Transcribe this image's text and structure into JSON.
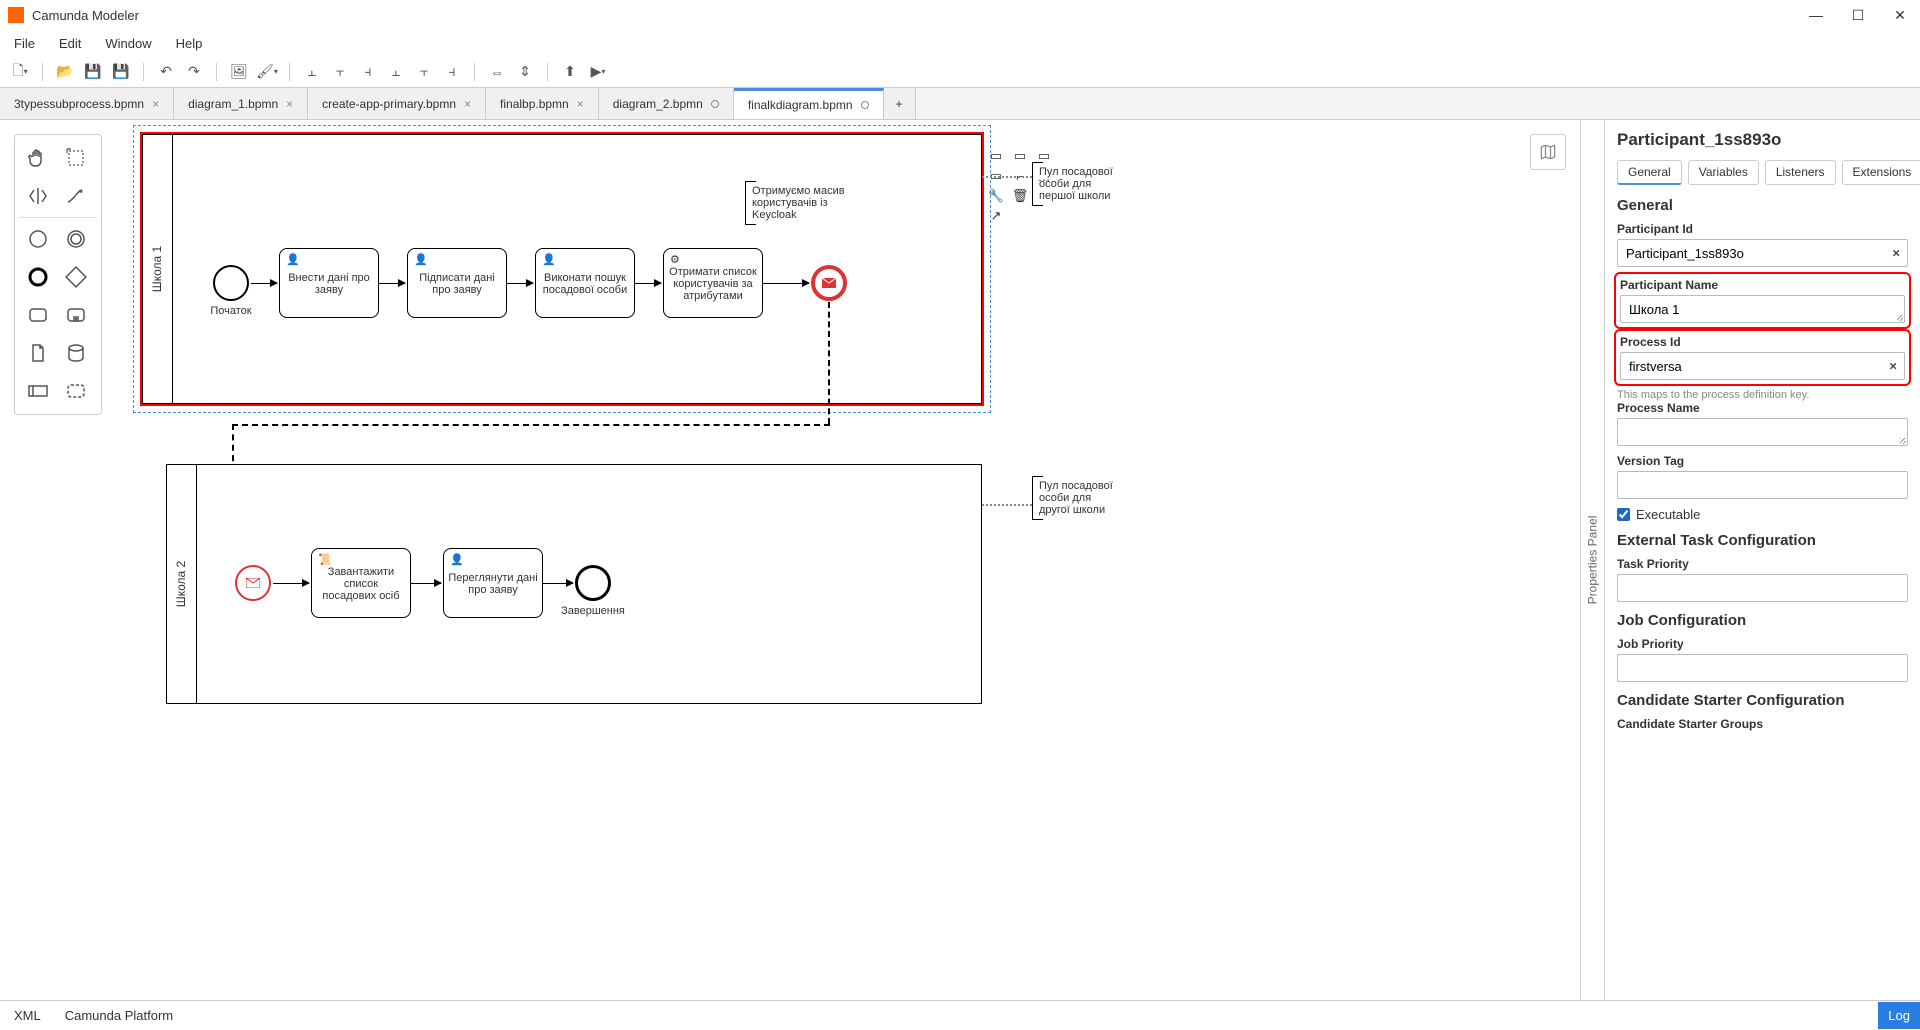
{
  "app": {
    "title": "Camunda Modeler"
  },
  "menu": {
    "file": "File",
    "edit": "Edit",
    "window": "Window",
    "help": "Help"
  },
  "tabs": [
    {
      "label": "3typessubprocess.bpmn",
      "dirty": false,
      "active": false
    },
    {
      "label": "diagram_1.bpmn",
      "dirty": false,
      "active": false
    },
    {
      "label": "create-app-primary.bpmn",
      "dirty": false,
      "active": false
    },
    {
      "label": "finalbp.bpmn",
      "dirty": false,
      "active": false
    },
    {
      "label": "diagram_2.bpmn",
      "dirty": true,
      "active": false
    },
    {
      "label": "finalkdiagram.bpmn",
      "dirty": true,
      "active": true
    }
  ],
  "pool1": {
    "name": "Школа 1",
    "start_label": "Початок",
    "t1": "Внести дані про заяву",
    "t2": "Підписати дані про заяву",
    "t3": "Виконати пошук посадової особи",
    "t4": "Отримати список користувачів за атрибутами",
    "annot1": "Отримуємо масив користувачів із Keycloak",
    "annot_ext": "Пул посадової особи для першої школи"
  },
  "pool2": {
    "name": "Школа 2",
    "t1": "Завантажити список посадових осіб",
    "t2": "Переглянути дані про заяву",
    "end_label": "Завершення",
    "annot_ext": "Пул посадової особи для другої школи"
  },
  "props": {
    "panel_label": "Properties Panel",
    "title": "Participant_1ss893o",
    "tabs": {
      "general": "General",
      "variables": "Variables",
      "listeners": "Listeners",
      "extensions": "Extensions"
    },
    "section_general": "General",
    "participant_id_label": "Participant Id",
    "participant_id": "Participant_1ss893o",
    "participant_name_label": "Participant Name",
    "participant_name": "Школа 1",
    "process_id_label": "Process Id",
    "process_id": "firstversa",
    "process_id_help": "This maps to the process definition key.",
    "process_name_label": "Process Name",
    "process_name": "",
    "version_tag_label": "Version Tag",
    "version_tag": "",
    "executable_label": "Executable",
    "section_ext": "External Task Configuration",
    "task_priority_label": "Task Priority",
    "task_priority": "",
    "section_job": "Job Configuration",
    "job_priority_label": "Job Priority",
    "job_priority": "",
    "section_cand": "Candidate Starter Configuration",
    "cand_groups_label": "Candidate Starter Groups"
  },
  "footer": {
    "xml": "XML",
    "platform": "Camunda Platform",
    "log": "Log"
  }
}
